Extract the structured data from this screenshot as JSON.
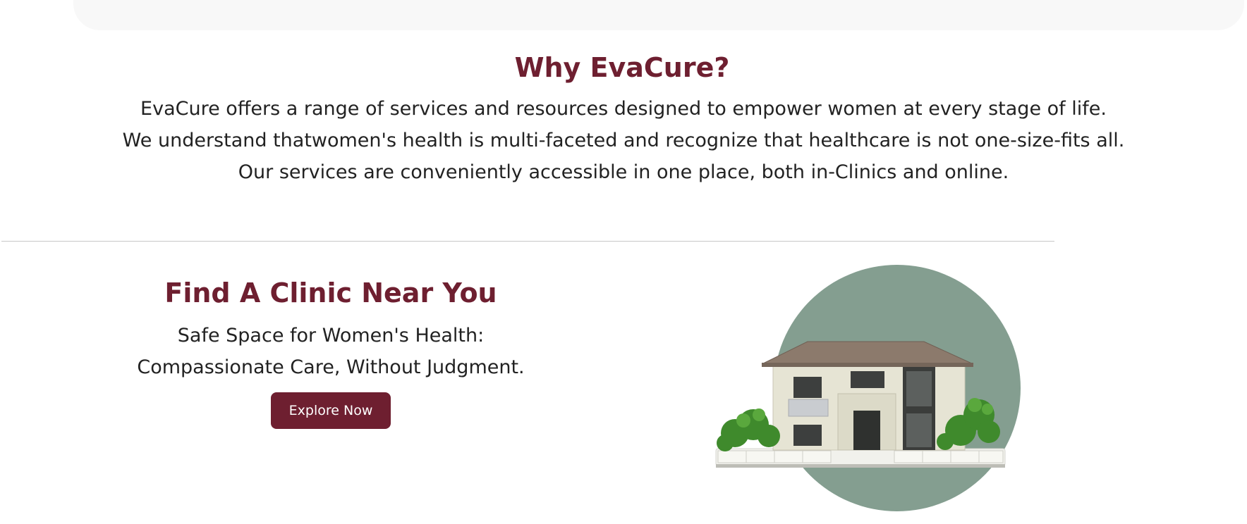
{
  "why": {
    "title": "Why EvaCure?",
    "lines": [
      "EvaCure offers a range of services and resources designed to empower women at every stage of life.",
      "We understand thatwomen's health is multi-faceted and recognize that healthcare is not one-size-fits all.",
      "Our services are conveniently accessible in one place, both in-Clinics and online."
    ]
  },
  "clinic": {
    "title": "Find A Clinic Near You",
    "subtitle_lines": [
      "Safe Space for Women's Health:",
      "Compassionate Care, Without Judgment."
    ],
    "button_label": "Explore Now",
    "image": "house-illustration"
  },
  "colors": {
    "brand": "#6e1f30",
    "circle": "#849e90",
    "text": "#222222"
  }
}
